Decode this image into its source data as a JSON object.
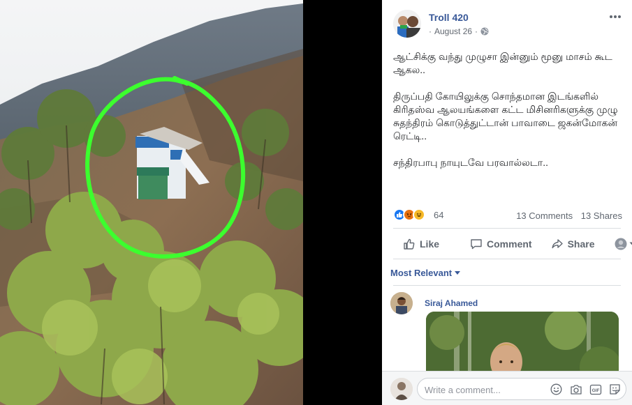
{
  "post": {
    "page_name": "Troll 420",
    "date": "August 26",
    "separator": "·",
    "privacy_icon": "globe-icon",
    "text": [
      "ஆட்சிக்கு வந்து முழுசா இன்னும் மூனு மாசம் கூட ஆகல..",
      "திருப்பதி கோயிலுக்கு சொந்தமான இடங்களில் கிரிதஸ்வ ஆலயங்களை கட்ட மிசினரிகளுக்கு முழு சுதந்திரம் கொடுத்துட்டான் பாவாடை ஜகன்மோகன் ரெட்டி..",
      "சந்திரபாபு நாயுடவே பரவால்லடா.."
    ]
  },
  "reactions": {
    "types": [
      "like",
      "angry",
      "haha"
    ],
    "count": "64",
    "comments": "13 Comments",
    "shares": "13 Shares"
  },
  "actions": {
    "like": "Like",
    "comment": "Comment",
    "share": "Share"
  },
  "comments": {
    "sort_label": "Most Relevant",
    "items": [
      {
        "author": "Siraj Ahamed"
      }
    ]
  },
  "composer": {
    "placeholder": "Write a comment...",
    "icons": [
      "emoji-icon",
      "camera-icon",
      "gif-icon",
      "sticker-icon"
    ]
  },
  "colors": {
    "link": "#385898",
    "secondary_text": "#606770",
    "highlight_circle": "#3cff2e",
    "like_blue": "#1877f2",
    "reaction_yellow": "#f7b928",
    "angry_orange": "#e9710f"
  }
}
